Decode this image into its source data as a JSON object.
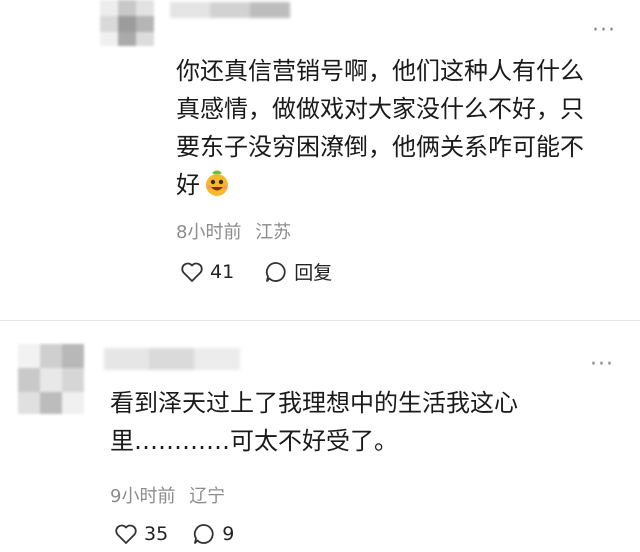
{
  "comments": [
    {
      "text_lines": [
        "你还真信营销号啊，他们这种人有什么",
        "真感情，做做戏对大家没什么不好，只",
        "要东子没穷困潦倒，他俩关系咋可能不",
        "好"
      ],
      "emoji": "grinning-face-emoji",
      "time": "8小时前",
      "location": "江苏",
      "likes": "41",
      "reply_label": "回复",
      "more_label": "···"
    },
    {
      "text_lines": [
        "看到泽天过上了我理想中的生活我这心",
        "里…………可太不好受了。"
      ],
      "time": "9小时前",
      "location": "辽宁",
      "likes": "35",
      "replies": "9",
      "more_label": "···"
    }
  ],
  "icons": {
    "like": "heart-outline-icon",
    "reply": "speech-bubble-icon",
    "more": "ellipsis-icon"
  }
}
